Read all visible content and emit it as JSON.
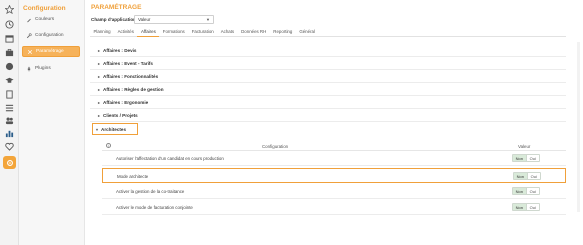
{
  "rail": {
    "icons": [
      "star-icon",
      "history-icon",
      "calendar-icon",
      "briefcase-icon",
      "globe-icon",
      "graduation-cap-icon",
      "document-icon",
      "settings-sliders-icon",
      "cart-icon",
      "users-icon",
      "bar-chart-icon",
      "heartbeat-icon",
      "gear-icon"
    ]
  },
  "nav": {
    "title": "Configuration",
    "items": [
      {
        "label": "Couleurs",
        "icon": "brush-icon"
      },
      {
        "label": "Configuration",
        "icon": "wrench-icon"
      },
      {
        "label": "Paramétrage",
        "icon": "tools-icon"
      },
      {
        "label": "Plugins",
        "icon": "plug-icon"
      }
    ],
    "selected_index": 2
  },
  "main": {
    "title": "PARAMÉTRAGE",
    "field_label": "Champ d'application :",
    "field_value": "Valeur",
    "tabs": [
      "Planning",
      "Activités",
      "Affaires",
      "Formations",
      "Facturation",
      "Achats",
      "Données RH",
      "Reporting",
      "Général"
    ],
    "active_tab": 2,
    "sections": [
      "Affaires : Devis",
      "Affaires : Event - Tarifs",
      "Affaires : Fonctionnalités",
      "Affaires : Règles de gestion",
      "Affaires : Ergonomie",
      "Clients / Projets"
    ],
    "open_section": "Architectes",
    "table": {
      "col_config": "Configuration",
      "col_value": "Valeur",
      "info_glyph": "i",
      "rows": [
        {
          "label": "Autoriser l'affectation d'un candidat en cours production",
          "no": "Non",
          "yes": "Oui"
        },
        {
          "label": "Mode architecte",
          "no": "Non",
          "yes": "Oui"
        },
        {
          "label": "Activer la gestion de la co-traitance",
          "no": "Non",
          "yes": "Oui"
        },
        {
          "label": "Activer le mode de facturation conjointe",
          "no": "Non",
          "yes": "Oui"
        }
      ]
    }
  },
  "colors": {
    "accent": "#f0a03a",
    "toggle_off_bg": "#d9ead9"
  }
}
